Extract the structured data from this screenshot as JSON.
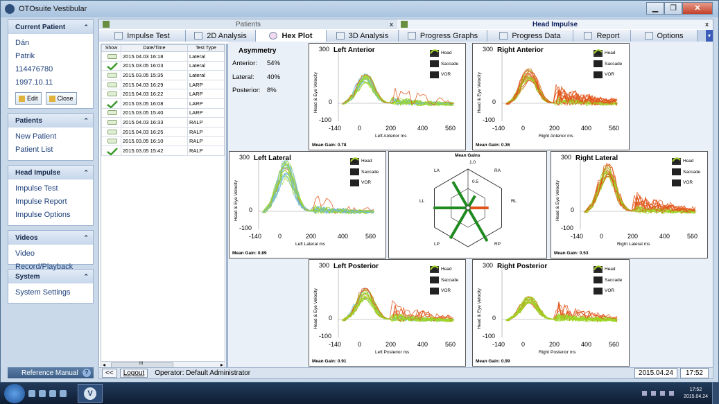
{
  "window": {
    "title": "OTOsuite Vestibular",
    "minimize": "▁",
    "maximize": "❐",
    "close": "✕"
  },
  "sidebar": {
    "current_patient": {
      "header": "Current Patient",
      "lines": [
        "Dán",
        "Patrik",
        "114476780",
        "1997.10.11"
      ],
      "edit": "Edit",
      "close": "Close"
    },
    "patients": {
      "header": "Patients",
      "items": [
        "New Patient",
        "Patient List"
      ]
    },
    "head_impulse": {
      "header": "Head Impulse",
      "items": [
        "Impulse Test",
        "Impulse Report",
        "Impulse Options"
      ]
    },
    "videos": {
      "header": "Videos",
      "items": [
        "Video Record/Playback"
      ]
    },
    "system": {
      "header": "System",
      "items": [
        "System Settings"
      ]
    },
    "reference": "Reference Manual"
  },
  "doc_tabs": [
    {
      "label": "Patients",
      "close": "x"
    },
    {
      "label": "Head Impulse",
      "close": "x"
    }
  ],
  "tabs": [
    "Impulse Test",
    "2D Analysis",
    "Hex Plot",
    "3D Analysis",
    "Progress Graphs",
    "Progress Data",
    "Report",
    "Options"
  ],
  "selected_tab": "Hex Plot",
  "test_table": {
    "headers": [
      "Show",
      "Date/Time",
      "Test Type"
    ],
    "rows": [
      {
        "show": false,
        "dt": "2015.04.03 16:18",
        "type": "Lateral"
      },
      {
        "show": true,
        "dt": "2015.03.05 16:03",
        "type": "Lateral"
      },
      {
        "show": false,
        "dt": "2015.03.05 15:35",
        "type": "Lateral"
      },
      {
        "show": false,
        "dt": "2015.04.03 16:29",
        "type": "LARP"
      },
      {
        "show": false,
        "dt": "2015.04.03 16:22",
        "type": "LARP"
      },
      {
        "show": true,
        "dt": "2015.03.05 16:08",
        "type": "LARP"
      },
      {
        "show": false,
        "dt": "2015.03.05 15:40",
        "type": "LARP"
      },
      {
        "show": false,
        "dt": "2015.04.03 16:33",
        "type": "RALP"
      },
      {
        "show": false,
        "dt": "2015.04.03 16:25",
        "type": "RALP"
      },
      {
        "show": false,
        "dt": "2015.03.05 16:10",
        "type": "RALP"
      },
      {
        "show": true,
        "dt": "2015.03.05 15:42",
        "type": "RALP"
      }
    ],
    "scroll_left": "◂",
    "scroll_right": "▸",
    "scroll_grip": "III"
  },
  "asymmetry": {
    "title": "Asymmetry",
    "rows": [
      {
        "label": "Anterior:",
        "value": "54%"
      },
      {
        "label": "Lateral:",
        "value": "40%"
      },
      {
        "label": "Posterior:",
        "value": "8%"
      }
    ]
  },
  "legend": [
    "Head",
    "Saccade",
    "VOR"
  ],
  "colors": {
    "head": "#6fb6e6",
    "saccade": "#e0561a",
    "vor": "#9ed627",
    "gain_bar": "#1f8a1f",
    "gain_bar_orange": "#e0561a"
  },
  "y_axis_label": "Head & Eye Velocity",
  "y_ticks": [
    "300",
    "0",
    "-100"
  ],
  "x_ticks": [
    "-140",
    "0",
    "200",
    "400",
    "560"
  ],
  "plots": [
    {
      "title": "Left Anterior",
      "xlabel": "Left Anterior ms",
      "gain": "Mean Gain: 0.78"
    },
    {
      "title": "Right Anterior",
      "xlabel": "Right Anterior ms",
      "gain": "Mean Gain: 0.36"
    },
    {
      "title": "Left Lateral",
      "xlabel": "Left Lateral ms",
      "gain": "Mean Gain: 0.89"
    },
    {
      "title": "Right Lateral",
      "xlabel": "Right Lateral ms",
      "gain": "Mean Gain: 0.53"
    },
    {
      "title": "Left Posterior",
      "xlabel": "Left Posterior ms",
      "gain": "Mean Gain: 0.91"
    },
    {
      "title": "Right Posterior",
      "xlabel": "Right Posterior ms",
      "gain": "Mean Gain: 0.99"
    }
  ],
  "hex": {
    "title": "Mean Gains",
    "scale_top": "1.0",
    "scale_mid": "0.5",
    "labels": {
      "LA": "LA",
      "RA": "RA",
      "LL": "LL",
      "RL": "RL",
      "LP": "LP",
      "RP": "RP"
    },
    "gains": {
      "LA": 0.78,
      "RA": 0.36,
      "LL": 0.89,
      "RL": 0.53,
      "LP": 0.91,
      "RP": 0.99
    }
  },
  "status": {
    "back": "<<",
    "logout": "Logout",
    "operator": "Operator: Default Administrator",
    "date": "2015.04.24",
    "time": "17:52"
  },
  "taskbar": {
    "time": "17:52",
    "date": "2015.04.24",
    "app_logo": "V"
  }
}
